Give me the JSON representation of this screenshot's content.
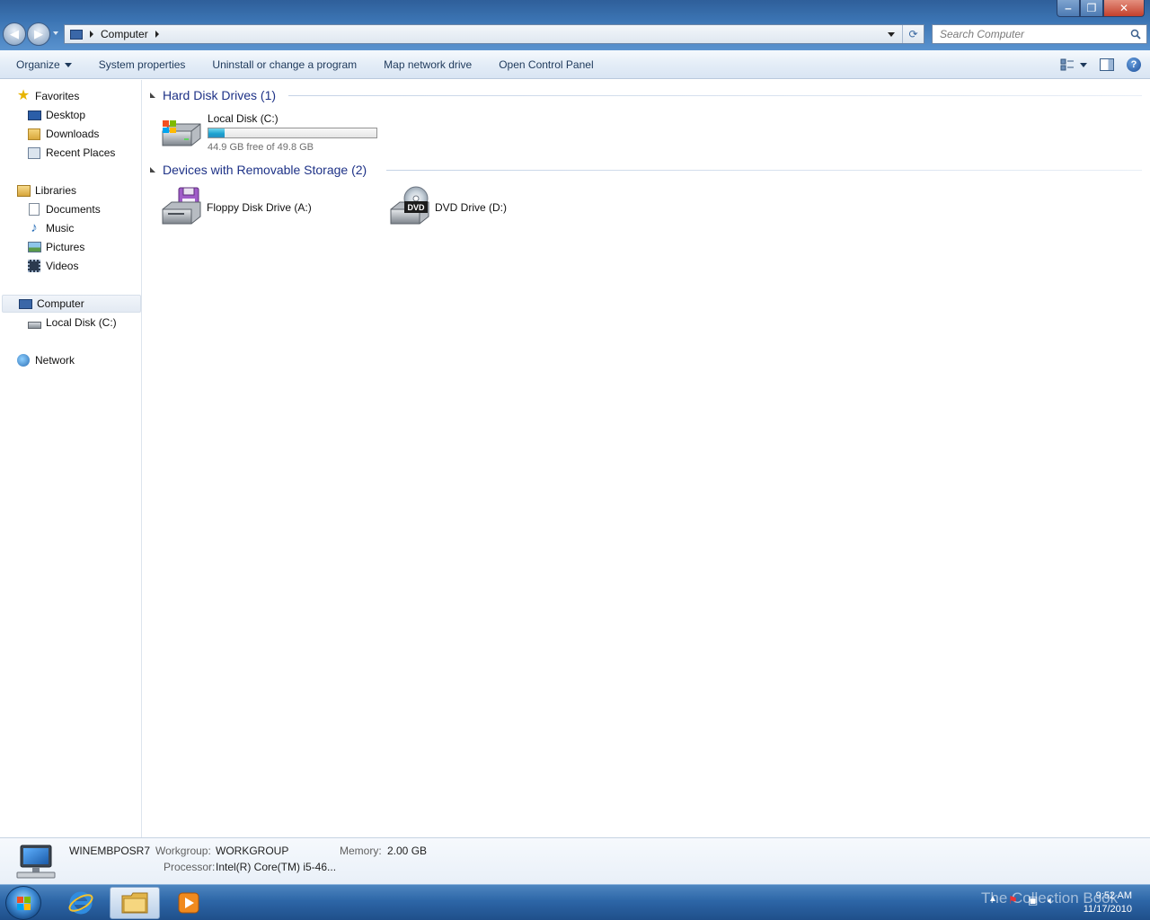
{
  "window": {
    "minimize": "‒",
    "maximize": "❐",
    "close": "✕"
  },
  "address": {
    "location": "Computer"
  },
  "search": {
    "placeholder": "Search Computer"
  },
  "toolbar": {
    "organize": "Organize",
    "system_properties": "System properties",
    "uninstall": "Uninstall or change a program",
    "map_drive": "Map network drive",
    "control_panel": "Open Control Panel",
    "help": "?"
  },
  "navigation": {
    "favorites": {
      "label": "Favorites",
      "items": [
        "Desktop",
        "Downloads",
        "Recent Places"
      ]
    },
    "libraries": {
      "label": "Libraries",
      "items": [
        "Documents",
        "Music",
        "Pictures",
        "Videos"
      ]
    },
    "computer": {
      "label": "Computer",
      "items": [
        "Local Disk (C:)"
      ]
    },
    "network": {
      "label": "Network"
    }
  },
  "content": {
    "hard_disks": {
      "header": "Hard Disk Drives (1)",
      "drives": [
        {
          "name": "Local Disk (C:)",
          "free_text": "44.9 GB free of 49.8 GB",
          "used_fraction": 0.098
        }
      ]
    },
    "removable": {
      "header": "Devices with Removable Storage (2)",
      "devices": [
        {
          "name": "Floppy Disk Drive (A:)"
        },
        {
          "name": "DVD Drive (D:)",
          "badge": "DVD"
        }
      ]
    }
  },
  "details": {
    "computer_name": "WINEMBPOSR7",
    "workgroup_label": "Workgroup:",
    "workgroup_value": "WORKGROUP",
    "memory_label": "Memory:",
    "memory_value": "2.00 GB",
    "processor_label": "Processor:",
    "processor_value": "Intel(R) Core(TM) i5-46..."
  },
  "taskbar": {
    "watermark": "The Collection Book",
    "time": "9:52 AM",
    "date": "11/17/2010"
  },
  "colors": {
    "accent": "#1e3287",
    "progress": "#1ba1cf",
    "taskbar": "#2d66a7"
  }
}
